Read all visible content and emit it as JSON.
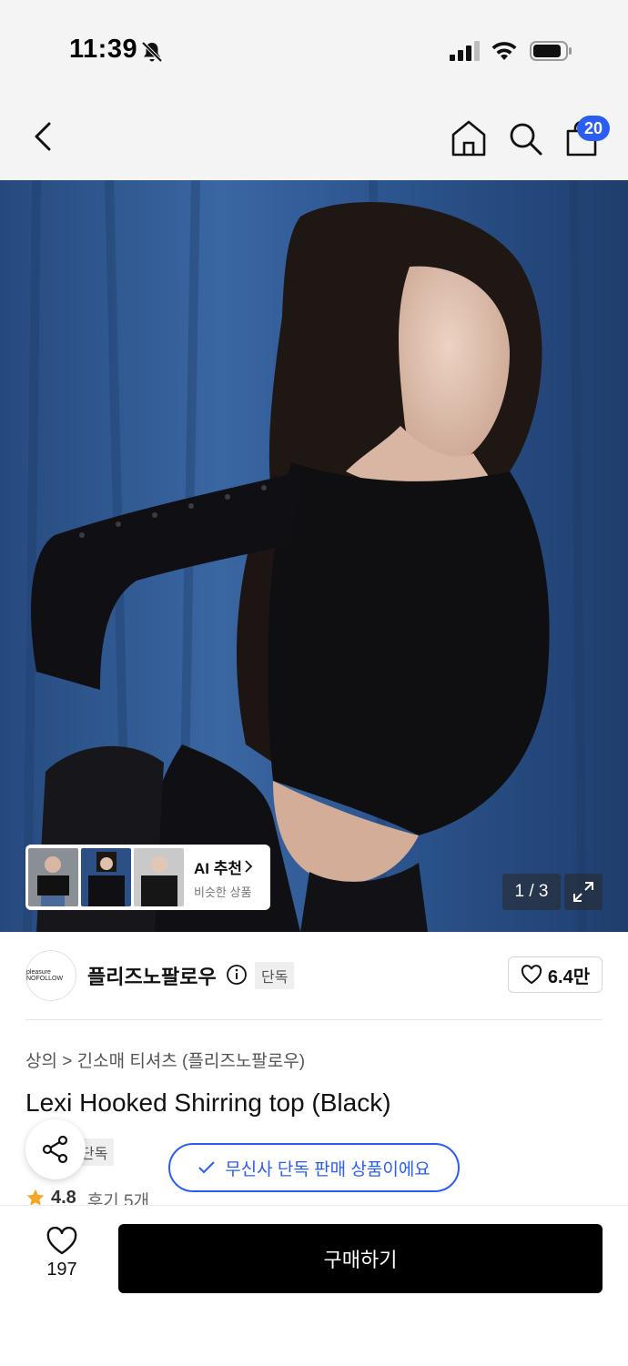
{
  "status_bar": {
    "time": "11:39"
  },
  "nav": {
    "cart_count": "20"
  },
  "gallery": {
    "counter": "1 / 3",
    "ai_title": "AI 추천",
    "ai_subtitle": "비슷한 상품"
  },
  "brand": {
    "logo_text": "pleasure NOFOLLOW",
    "name": "플리즈노팔로우",
    "tag": "단독",
    "likes": "6.4만"
  },
  "product": {
    "breadcrumb": "상의 > 긴소매 티셔츠 (플리즈노팔로우)",
    "title": "Lexi Hooked Shirring top (Black)",
    "tag": "단독",
    "exclusive_notice": "무신사 단독 판매 상품이에요",
    "rating": "4.8",
    "reviews": "후기 5개"
  },
  "bottom_bar": {
    "wish_count": "197",
    "buy_label": "구매하기"
  },
  "colors": {
    "accent_blue": "#2a5df4",
    "buy_button": "#000000",
    "star": "#f5a623"
  }
}
